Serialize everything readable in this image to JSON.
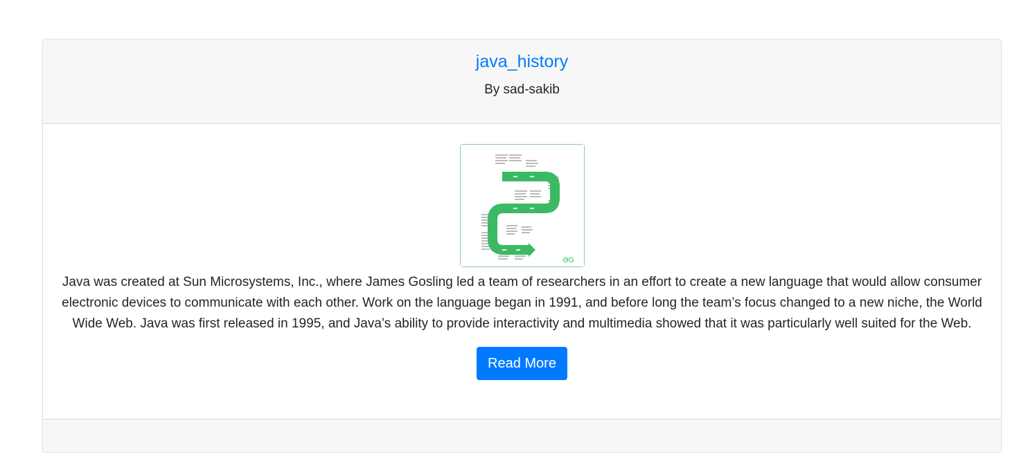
{
  "post": {
    "title": "java_history",
    "author": "By sad-sakib",
    "image_alt": "java-history-timeline-image",
    "body": "Java was created at Sun Microsystems, Inc., where James Gosling led a team of researchers in an effort to create a new language that would allow consumer electronic devices to communicate with each other. Work on the language began in 1991, and before long the team’s focus changed to a new niche, the World Wide Web. Java was first released in 1995, and Java’s ability to provide interactivity and multimedia showed that it was particularly well suited for the Web.",
    "read_more_label": "Read More"
  },
  "colors": {
    "link": "#007bff",
    "button": "#007bff",
    "header_bg": "#f7f7f7",
    "timeline_green": "#3cb964"
  }
}
